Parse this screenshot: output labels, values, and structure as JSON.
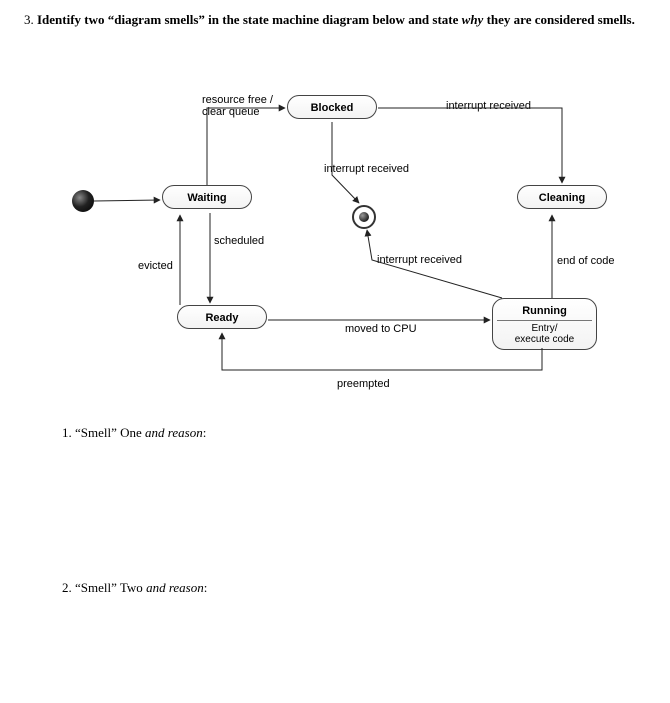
{
  "question": {
    "number": "3.",
    "prompt_pre": "Identify two “diagram smells” in the state machine diagram below and state ",
    "prompt_em": "why",
    "prompt_post": " they are considered smells."
  },
  "answer_spaces": {
    "one_label_pre": "1. “Smell” One ",
    "one_label_em": "and reason",
    "two_label_pre": "2. “Smell” Two ",
    "two_label_em": "and reason",
    "colon": ":"
  },
  "diagram": {
    "states": {
      "waiting": "Waiting",
      "blocked": "Blocked",
      "cleaning": "Cleaning",
      "ready": "Ready",
      "running_name": "Running",
      "running_entry": "Entry/",
      "running_action": "execute code"
    },
    "pseudo": {
      "initial": "initial-state",
      "final": "final-state"
    },
    "edges": {
      "init_wait": "",
      "wait_block": "resource free / clear queue",
      "block_final": "interrupt received",
      "block_clean": "interrupt received",
      "run_final": "interrupt received",
      "run_clean": "end of code",
      "wait_ready": "scheduled",
      "ready_wait": "evicted",
      "ready_run": "moved to CPU",
      "run_ready": "preempted"
    }
  }
}
